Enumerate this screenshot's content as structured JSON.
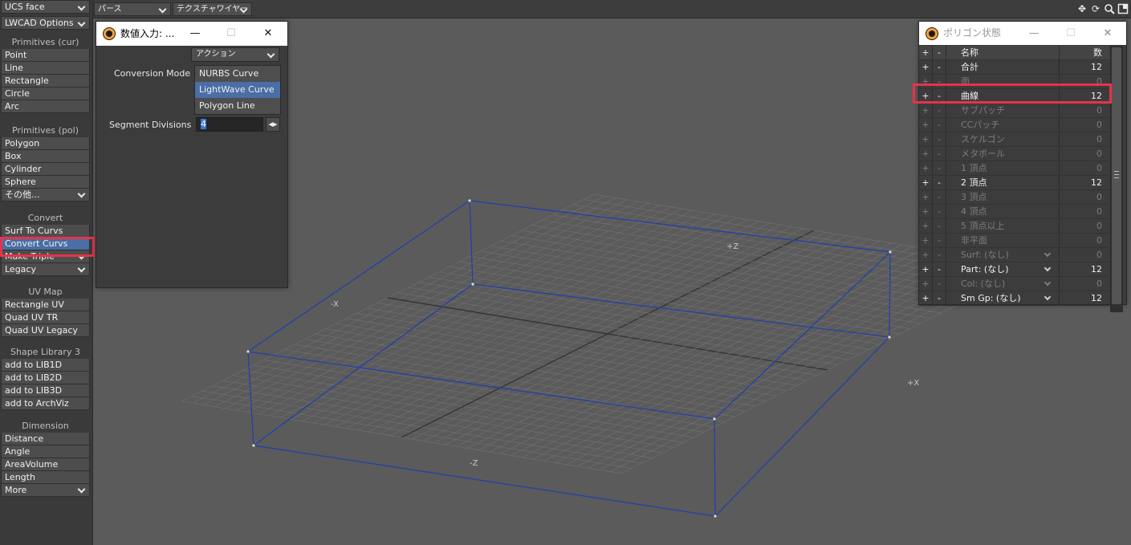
{
  "sidebar": {
    "top_dropdowns": [
      "UCS face",
      "LWCAD Options"
    ],
    "groups": [
      {
        "title": "Primitives (cur)",
        "items": [
          "Point",
          "Line",
          "Rectangle",
          "Circle",
          "Arc"
        ]
      },
      {
        "title": "Primitives (pol)",
        "items": [
          "Polygon",
          "Box",
          "Cylinder",
          "Sphere",
          "その他..."
        ]
      },
      {
        "title": "Convert",
        "items": [
          "Surf To Curvs",
          "Convert Curvs",
          "Make Triple",
          "Legacy"
        ]
      },
      {
        "title": "UV Map",
        "items": [
          "Rectangle UV",
          "Quad UV TR",
          "Quad UV Legacy"
        ]
      },
      {
        "title": "Shape Library 3",
        "items": [
          "add to LIB1D",
          "add to LIB2D",
          "add to LIB3D",
          "add to ArchViz"
        ]
      },
      {
        "title": "Dimension",
        "items": [
          "Distance",
          "Angle",
          "AreaVolume",
          "Length",
          "More"
        ]
      }
    ],
    "selected_item": "Convert Curvs"
  },
  "viewport": {
    "view_mode": "パース",
    "render_mode": "テクスチャワイヤー",
    "axis_labels": [
      "+Z",
      "-X",
      "+X",
      "-Z"
    ],
    "header_icons": [
      "move-icon",
      "refresh-icon",
      "zoom-icon",
      "maximize-icon"
    ]
  },
  "numeric_window": {
    "title": "数値入力: ...",
    "action_dropdown": "アクション",
    "conversion_mode_label": "Conversion Mode",
    "conversion_modes": [
      "NURBS Curve",
      "LightWave Curve",
      "Polygon Line"
    ],
    "selected_mode": "LightWave Curve",
    "segment_divisions_label": "Segment Divisions",
    "segment_divisions_value": "4"
  },
  "polygon_window": {
    "title": "ポリゴン状態",
    "headers": {
      "plus": "+",
      "minus": "-",
      "name": "名称",
      "count": "数"
    },
    "rows": [
      {
        "name": "合計",
        "count": "12",
        "active": true,
        "dropdown": false
      },
      {
        "name": "面",
        "count": "0",
        "active": false,
        "dropdown": false
      },
      {
        "name": "曲線",
        "count": "12",
        "active": true,
        "dropdown": false
      },
      {
        "name": "サブパッチ",
        "count": "0",
        "active": false,
        "dropdown": false
      },
      {
        "name": "CCパッチ",
        "count": "0",
        "active": false,
        "dropdown": false
      },
      {
        "name": "スケルゴン",
        "count": "0",
        "active": false,
        "dropdown": false
      },
      {
        "name": "メタボール",
        "count": "0",
        "active": false,
        "dropdown": false
      },
      {
        "name": "1 頂点",
        "count": "0",
        "active": false,
        "dropdown": false
      },
      {
        "name": "2 頂点",
        "count": "12",
        "active": true,
        "dropdown": false
      },
      {
        "name": "3 頂点",
        "count": "0",
        "active": false,
        "dropdown": false
      },
      {
        "name": "4 頂点",
        "count": "0",
        "active": false,
        "dropdown": false
      },
      {
        "name": "5 頂点以上",
        "count": "0",
        "active": false,
        "dropdown": false
      },
      {
        "name": "非平面",
        "count": "0",
        "active": false,
        "dropdown": false
      },
      {
        "name": "Surf: (なし)",
        "count": "0",
        "active": false,
        "dropdown": true
      },
      {
        "name": "Part: (なし)",
        "count": "12",
        "active": true,
        "dropdown": true
      },
      {
        "name": "Col: (なし)",
        "count": "0",
        "active": false,
        "dropdown": true
      },
      {
        "name": "Sm Gp: (なし)",
        "count": "12",
        "active": true,
        "dropdown": true
      }
    ]
  },
  "colors": {
    "highlight_red": "#e5334b",
    "selected_blue": "#4a6ea5",
    "wireframe_blue": "#1d3fae"
  }
}
